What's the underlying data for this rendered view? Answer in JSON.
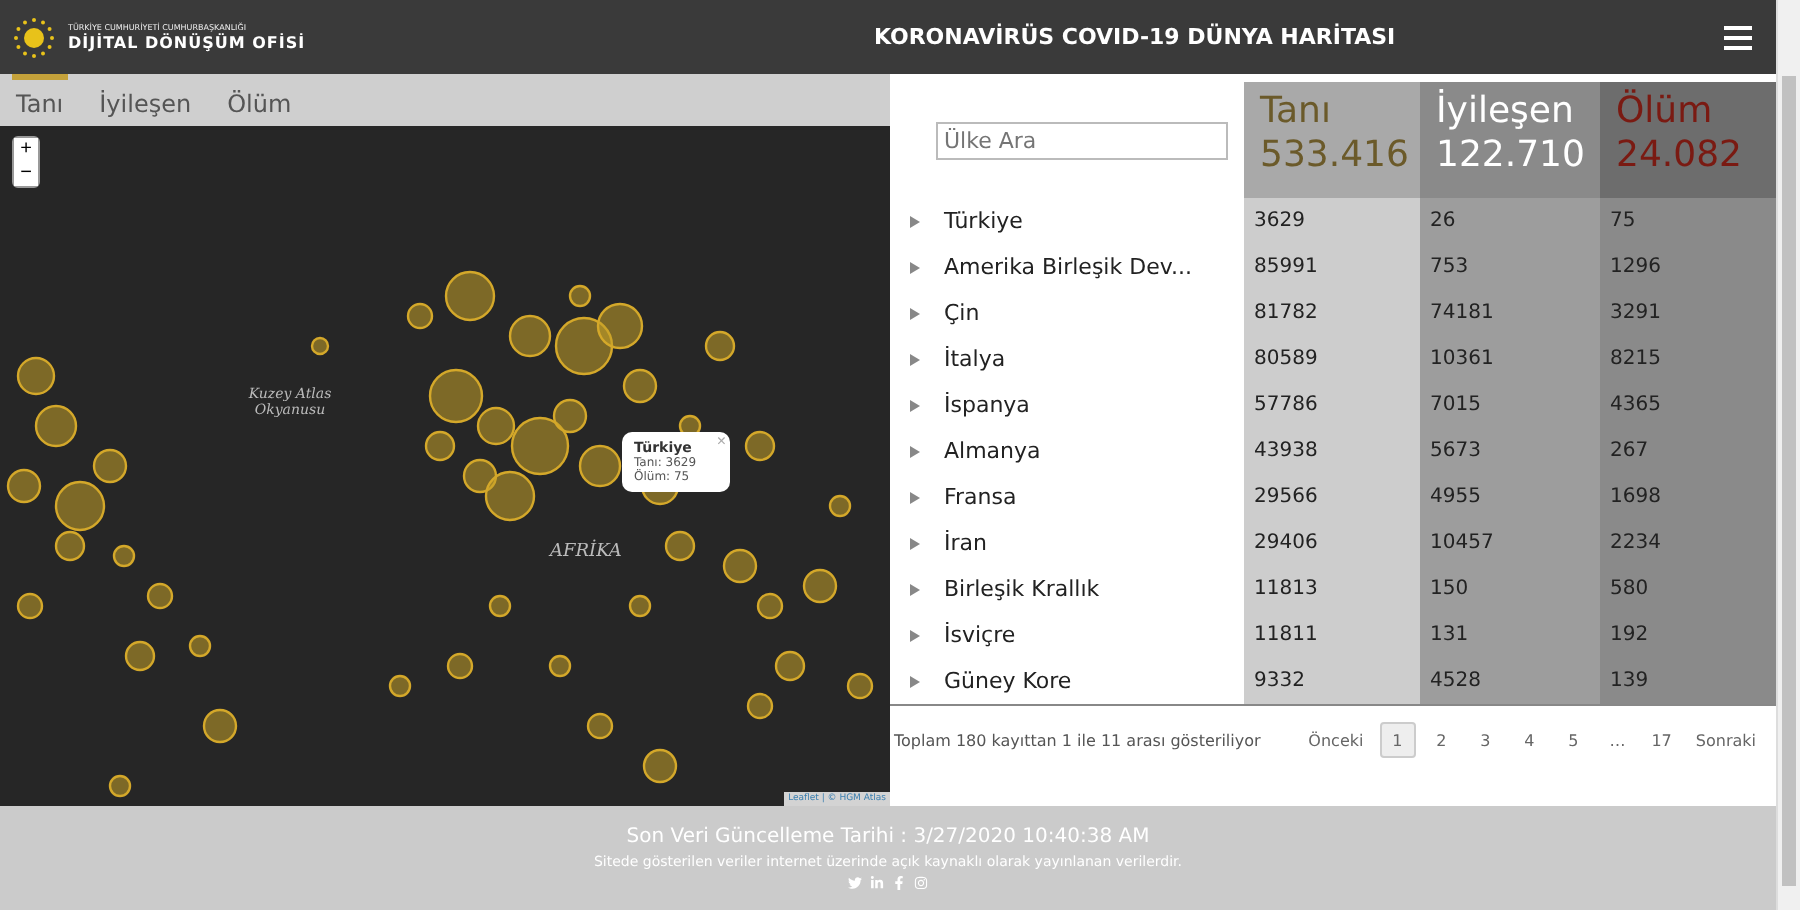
{
  "header": {
    "org_small": "TÜRKİYE CUMHURİYETİ CUMHURBAŞKANLIĞI",
    "org_name": "DİJİTAL DÖNÜŞÜM OFİSİ",
    "title": "KORONAVİRÜS COVID-19 DÜNYA HARİTASI"
  },
  "map_tabs": [
    {
      "label": "Tanı",
      "selected": true
    },
    {
      "label": "İyileşen",
      "selected": false
    },
    {
      "label": "Ölüm",
      "selected": false
    }
  ],
  "map": {
    "zoom_in": "+",
    "zoom_out": "−",
    "labels": [
      {
        "text": "Kuzey Atlas Okyanusu",
        "kind": "ocean"
      },
      {
        "text": "AFRİKA",
        "kind": "continent"
      }
    ],
    "popup": {
      "close": "×",
      "title": "Türkiye",
      "lines": [
        "Tanı: 3629",
        "Ölüm: 75"
      ]
    },
    "attribution": "Leaflet | © HGM Atlas"
  },
  "search": {
    "placeholder": "Ülke Ara"
  },
  "totals": [
    {
      "label": "Tanı",
      "value": "533.416"
    },
    {
      "label": "İyileşen",
      "value": "122.710"
    },
    {
      "label": "Ölüm",
      "value": "24.082"
    }
  ],
  "rows": [
    {
      "country": "Türkiye",
      "cases": "3629",
      "recovered": "26",
      "deaths": "75"
    },
    {
      "country": "Amerika Birleşik Dev...",
      "cases": "85991",
      "recovered": "753",
      "deaths": "1296"
    },
    {
      "country": "Çin",
      "cases": "81782",
      "recovered": "74181",
      "deaths": "3291"
    },
    {
      "country": "İtalya",
      "cases": "80589",
      "recovered": "10361",
      "deaths": "8215"
    },
    {
      "country": "İspanya",
      "cases": "57786",
      "recovered": "7015",
      "deaths": "4365"
    },
    {
      "country": "Almanya",
      "cases": "43938",
      "recovered": "5673",
      "deaths": "267"
    },
    {
      "country": "Fransa",
      "cases": "29566",
      "recovered": "4955",
      "deaths": "1698"
    },
    {
      "country": "İran",
      "cases": "29406",
      "recovered": "10457",
      "deaths": "2234"
    },
    {
      "country": "Birleşik Krallık",
      "cases": "11813",
      "recovered": "150",
      "deaths": "580"
    },
    {
      "country": "İsviçre",
      "cases": "11811",
      "recovered": "131",
      "deaths": "192"
    },
    {
      "country": "Güney Kore",
      "cases": "9332",
      "recovered": "4528",
      "deaths": "139"
    }
  ],
  "table_info": "Toplam 180 kayıttan 1 ile 11 arası gösteriliyor",
  "pagination": {
    "previous": "Önceki",
    "next": "Sonraki",
    "pages": [
      {
        "label": "1",
        "selected": true
      },
      {
        "label": "2",
        "selected": false
      },
      {
        "label": "3",
        "selected": false
      },
      {
        "label": "4",
        "selected": false
      },
      {
        "label": "5",
        "selected": false
      },
      {
        "label": "…",
        "selected": false
      },
      {
        "label": "17",
        "selected": false
      }
    ]
  },
  "footer": {
    "updated": "Son Veri Güncelleme Tarihi : 3/27/2020 10:40:38 AM",
    "note": "Sitede gösterilen veriler internet üzerinde açık kaynaklı olarak yayınlanan verilerdir."
  }
}
